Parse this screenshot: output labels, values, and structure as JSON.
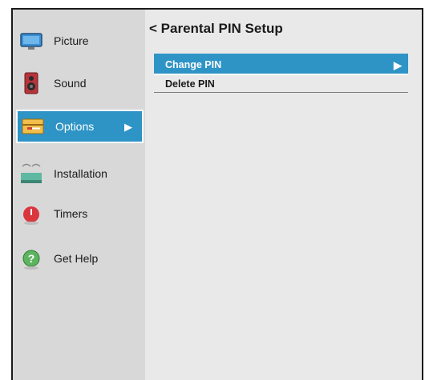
{
  "sidebar": {
    "items": [
      {
        "label": "Picture",
        "icon": "monitor-icon"
      },
      {
        "label": "Sound",
        "icon": "speaker-icon"
      },
      {
        "label": "Options",
        "icon": "options-icon",
        "selected": true,
        "arrow": "▶"
      },
      {
        "label": "Installation",
        "icon": "satellite-icon"
      },
      {
        "label": "Timers",
        "icon": "timer-icon"
      },
      {
        "label": "Get Help",
        "icon": "help-icon"
      }
    ]
  },
  "main": {
    "back_glyph": "<",
    "title": "Parental PIN Setup",
    "menu": [
      {
        "label": "Change PIN",
        "active": true,
        "arrow": "▶"
      },
      {
        "label": "Delete PIN",
        "active": false
      }
    ]
  },
  "colors": {
    "accent": "#2e94c6",
    "sidebar_bg": "#d8d8d8",
    "panel_bg": "#e9e9e9"
  }
}
